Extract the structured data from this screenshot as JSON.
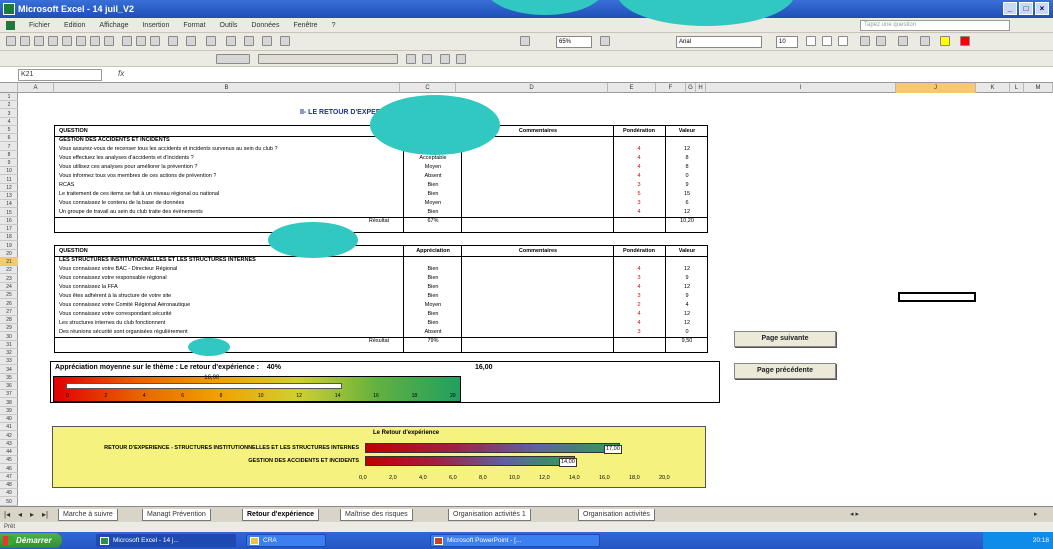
{
  "window": {
    "title": "Microsoft Excel - 14 juil_V2"
  },
  "menu": [
    "Fichier",
    "Edition",
    "Affichage",
    "Insertion",
    "Format",
    "Outils",
    "Données",
    "Fenêtre",
    "?"
  ],
  "ask_placeholder": "Tapez une question",
  "toolbar": {
    "zoom": "65%",
    "font": "Arial",
    "size": "10"
  },
  "formula": {
    "namebox": "K21",
    "fx": "fx"
  },
  "sheet_title": "II- LE RETOUR D'EXPERIENCE",
  "table1": {
    "headers": {
      "question": "QUESTION",
      "appreciation": "Appréciation",
      "comments": "Commentaires",
      "weight": "Pondération",
      "value": "Valeur"
    },
    "rows": [
      {
        "q": "GESTION DES ACCIDENTS ET INCIDENTS",
        "a": "",
        "w": "",
        "v": ""
      },
      {
        "q": "Vous assurez-vous de recenser tous les accidents et incidents survenus au sein du club ?",
        "a": "Bien",
        "w": "4",
        "v": "12"
      },
      {
        "q": "Vous effectuez les analyses d'accidents et d'incidents ?",
        "a": "Acceptable",
        "w": "4",
        "v": "8"
      },
      {
        "q": "Vous utilisez ces analyses pour améliorer la prévention ?",
        "a": "Moyen",
        "w": "4",
        "v": "8"
      },
      {
        "q": "Vous informez tous vos membres de ces actions de prévention ?",
        "a": "Absent",
        "w": "4",
        "v": "0"
      },
      {
        "q": "RCAS",
        "a": "Bien",
        "w": "3",
        "v": "9"
      },
      {
        "q": "Le traitement de ces items se fait à un niveau régional ou national",
        "a": "Bien",
        "w": "5",
        "v": "15"
      },
      {
        "q": "Vous connaissez le contenu de la base de données",
        "a": "Moyen",
        "w": "3",
        "v": "6"
      },
      {
        "q": "Un groupe de travail au sein du club traite des événements",
        "a": "Bien",
        "w": "4",
        "v": "12"
      }
    ],
    "result_label": "Résultat",
    "result_pct": "67%",
    "result_value": "10,20"
  },
  "table2": {
    "headers": {
      "question": "QUESTION",
      "appreciation": "Appréciation",
      "comments": "Commentaires",
      "weight": "Pondération",
      "value": "Valeur"
    },
    "rows": [
      {
        "q": "LES STRUCTURES INSTITUTIONNELLES ET LES STRUCTURES INTERNES",
        "a": "",
        "w": "",
        "v": ""
      },
      {
        "q": "Vous connaissez votre BAC - Directeur Régional",
        "a": "Bien",
        "w": "4",
        "v": "12"
      },
      {
        "q": "Vous connaissez votre responsable régional",
        "a": "Bien",
        "w": "3",
        "v": "9"
      },
      {
        "q": "Vous connaissez la FFA",
        "a": "Bien",
        "w": "4",
        "v": "12"
      },
      {
        "q": "Vous êtes adhérent à la structure de votre site",
        "a": "Bien",
        "w": "3",
        "v": "9"
      },
      {
        "q": "Vous connaissez votre Comité Régional Aéronautique",
        "a": "Moyen",
        "w": "2",
        "v": "4"
      },
      {
        "q": "Vous connaissez votre correspondant sécurité",
        "a": "Bien",
        "w": "4",
        "v": "12"
      },
      {
        "q": "Les structures internes du club fonctionnent",
        "a": "Bien",
        "w": "4",
        "v": "12"
      },
      {
        "q": "Des réunions sécurité sont organisées régulièrement",
        "a": "Absent",
        "w": "3",
        "v": "0"
      }
    ],
    "result_label": "Résultat",
    "result_pct": "79%",
    "result_value": "9,50"
  },
  "synthesis": {
    "title": "Appréciation moyenne sur le thème : Le retour d'expérience :",
    "value1": "40%",
    "value2": "16,00",
    "gauge_value": "16,00",
    "gauge_fraction": 0.8,
    "ticks": [
      "0",
      "2",
      "4",
      "6",
      "8",
      "10",
      "12",
      "14",
      "16",
      "18",
      "20"
    ]
  },
  "retour": {
    "title": "Le Retour d'expérience",
    "rows": [
      {
        "label": "RETOUR D'EXPERIENCE - STRUCTURES INSTITUTIONNELLES ET LES STRUCTURES INTERNES",
        "value": "17,00",
        "fraction": 0.85
      },
      {
        "label": "GESTION DES ACCIDENTS ET INCIDENTS",
        "value": "14,00",
        "fraction": 0.7
      }
    ],
    "ticks": [
      "0,0",
      "2,0",
      "4,0",
      "6,0",
      "8,0",
      "10,0",
      "12,0",
      "14,0",
      "16,0",
      "18,0",
      "20,0"
    ]
  },
  "buttons": {
    "next": "Page suivante",
    "prev": "Page précédente"
  },
  "tabs": [
    "Marche à suivre",
    "Managt Prévention",
    "Retour d'expérience",
    "Maîtrise des risques",
    "Organisation activités 1",
    "Organisation activités"
  ],
  "active_tab": "Retour d'expérience",
  "status": "Prêt",
  "taskbar": {
    "start": "Démarrer",
    "tasks": [
      "Microsoft Excel - 14 j...",
      "CRA",
      "Microsoft PowerPoint - [..."
    ],
    "clock": "20:18"
  }
}
